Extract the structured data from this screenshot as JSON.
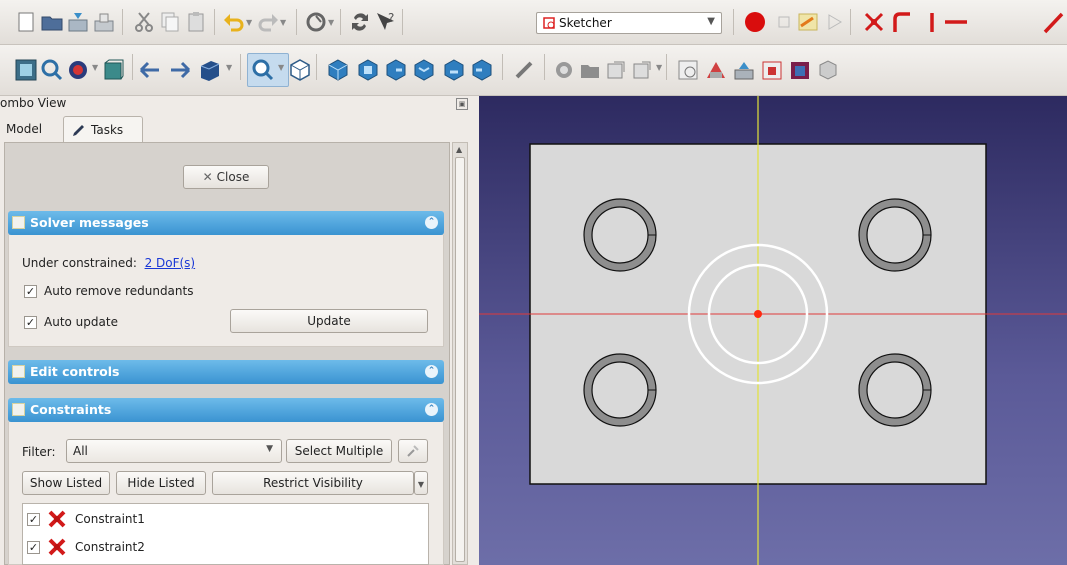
{
  "toolbar1": {
    "workbench_select": {
      "value": "Sketcher"
    },
    "icons": [
      "new-file-icon",
      "open-file-icon",
      "save-icon",
      "save-as-icon",
      "cut-icon",
      "copy-icon",
      "paste-icon",
      "undo-icon",
      "redo-icon",
      "refresh-icon",
      "macro-icon",
      "whats-this-icon",
      "record-macro-icon",
      "stop-macro-icon",
      "edit-macro-icon",
      "run-macro-icon",
      "sketch-point-icon",
      "sketch-polyline-icon",
      "sketch-vertical-line-icon",
      "sketch-line-icon"
    ]
  },
  "toolbar2": {
    "icons": [
      "std-view-fit-all-icon",
      "view-fit-selection-icon",
      "draw-style-icon",
      "bounding-box-icon",
      "back-view-icon",
      "forward-view-icon",
      "workbench-parts-icon",
      "zoom-icon",
      "isometric-view-icon",
      "front-view-icon",
      "top-view-icon",
      "right-view-icon",
      "rear-view-icon",
      "bottom-view-icon",
      "left-view-icon",
      "measure-icon",
      "part-icon",
      "group-icon",
      "link-icon",
      "link-actions-icon",
      "sketch-new-icon",
      "sketch-leave-icon",
      "sketch-view-icon",
      "sketch-section-icon",
      "sketch-map-icon",
      "sketch-reorient-icon"
    ]
  },
  "combo": {
    "title": "ombo View",
    "tabs": {
      "model": "Model",
      "tasks": "Tasks"
    },
    "close_button": "Close"
  },
  "solver": {
    "header": "Solver messages",
    "under_constrained_text": "Under constrained:",
    "dof_link": "2 DoF(s)",
    "auto_remove_label": "Auto remove redundants",
    "auto_remove_checked": true,
    "auto_update_label": "Auto update",
    "auto_update_checked": true,
    "update_button": "Update"
  },
  "edit_controls": {
    "header": "Edit controls"
  },
  "constraints": {
    "header": "Constraints",
    "filter_label": "Filter:",
    "filter_value": "All",
    "select_multiple": "Select Multiple",
    "show_listed": "Show Listed",
    "hide_listed": "Hide Listed",
    "restrict_visibility": "Restrict Visibility",
    "items": [
      {
        "label": "Constraint1",
        "checked": true
      },
      {
        "label": "Constraint2",
        "checked": true
      }
    ]
  },
  "colors": {
    "section_header": "#3a93d1",
    "axis_vertical": "#e3e33a",
    "axis_horizontal": "#e03a3a",
    "origin_point": "#ff2a10",
    "sketch_plate": "#d9d9d9",
    "selected_circle": "#ffffff",
    "viewport_bg_top": "#2d2a60",
    "viewport_bg_bottom": "#6d6ea8"
  }
}
